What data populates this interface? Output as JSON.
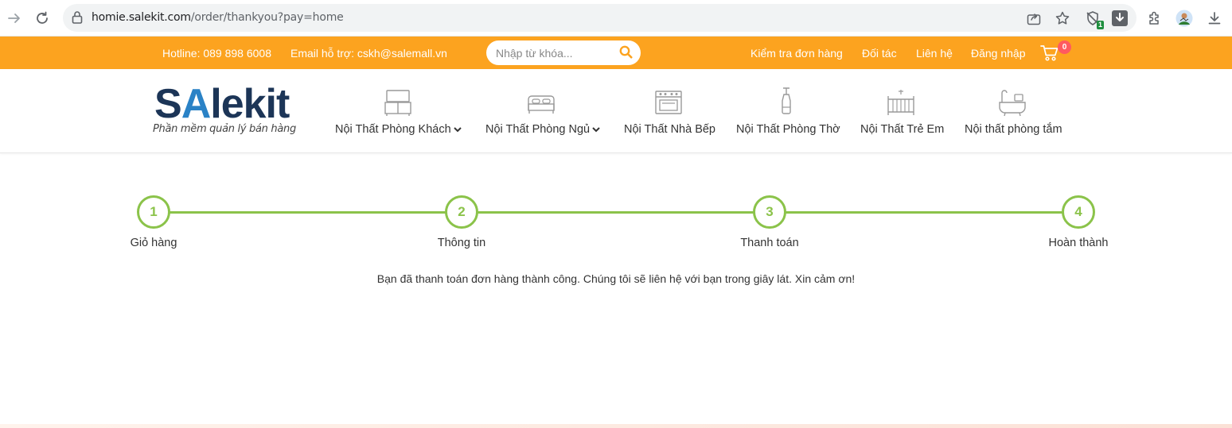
{
  "browser": {
    "url_host": "homie.salekit.com",
    "url_path": "/order/thankyou?pay=home",
    "extension_badge": "1"
  },
  "topbar": {
    "hotline": "Hotline: 089 898 6008",
    "email": "Email hỗ trợ: cskh@salemall.vn",
    "search_placeholder": "Nhập từ khóa...",
    "links": [
      "Kiểm tra đơn hàng",
      "Đối tác",
      "Liên hệ",
      "Đăng nhập"
    ],
    "cart_count": "0",
    "color": "#fca31f"
  },
  "logo": {
    "word_s": "S",
    "word_a": "A",
    "word_rest": "lekit",
    "tagline": "Phần mềm quản lý bán hàng"
  },
  "categories": [
    {
      "label": "Nội Thất Phòng Khách",
      "icon": "tv-cabinet-icon",
      "dropdown": true
    },
    {
      "label": "Nội Thất Phòng Ngủ",
      "icon": "bed-icon",
      "dropdown": true
    },
    {
      "label": "Nội Thất Nhà Bếp",
      "icon": "stove-icon",
      "dropdown": false
    },
    {
      "label": "Nội Thất Phòng Thờ",
      "icon": "lamp-icon",
      "dropdown": false
    },
    {
      "label": "Nội Thất Trẻ Em",
      "icon": "crib-icon",
      "dropdown": false
    },
    {
      "label": "Nội thất phòng tắm",
      "icon": "bathtub-icon",
      "dropdown": false
    }
  ],
  "steps": [
    {
      "number": "1",
      "label": "Giỏ hàng"
    },
    {
      "number": "2",
      "label": "Thông tin"
    },
    {
      "number": "3",
      "label": "Thanh toán"
    },
    {
      "number": "4",
      "label": "Hoàn thành"
    }
  ],
  "step_color": "#8bc34a",
  "message": "Bạn đã thanh toán đơn hàng thành công. Chúng tôi sẽ liên hệ với bạn trong giây lát. Xin cảm ơn!"
}
